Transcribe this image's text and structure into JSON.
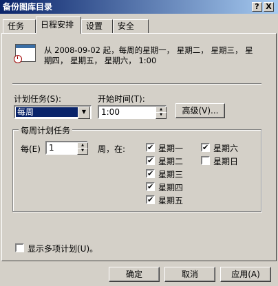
{
  "window": {
    "title": "备份图库目录",
    "help_label": "?",
    "close_label": "X"
  },
  "tabs": [
    {
      "label": "任务"
    },
    {
      "label": "日程安排"
    },
    {
      "label": "设置"
    },
    {
      "label": "安全"
    }
  ],
  "schedule": {
    "description_line1": "从 2008-09-02 起，每周的星期一， 星期二， 星期三， 星",
    "description_line2": "期四， 星期五， 星期六， 1:00",
    "task_label": "计划任务(S):",
    "task_value": "每周",
    "start_time_label": "开始时间(T):",
    "start_time_value": "1:00",
    "advanced_button": "高级(V)..."
  },
  "weekly": {
    "group_title": "每周计划任务",
    "every_label": "每(E)",
    "every_value": "1",
    "weeks_on_label": "周，在:",
    "days": [
      {
        "label": "星期一",
        "checked": true
      },
      {
        "label": "星期二",
        "checked": true
      },
      {
        "label": "星期三",
        "checked": true
      },
      {
        "label": "星期四",
        "checked": true
      },
      {
        "label": "星期五",
        "checked": true
      },
      {
        "label": "星期六",
        "checked": true
      },
      {
        "label": "星期日",
        "checked": false
      }
    ]
  },
  "footer": {
    "multiple_schedules_label": "显示多项计划(U)。",
    "multiple_schedules_checked": false,
    "ok_label": "确定",
    "cancel_label": "取消",
    "apply_label": "应用(A)"
  },
  "icons": {
    "checkmark": "✔",
    "dropdown": "▼",
    "spin_up": "▲",
    "spin_down": "▼"
  },
  "colors": {
    "titlebar_start": "#0a246a",
    "titlebar_end": "#a6caf0",
    "dialog_bg": "#d4d0c8",
    "selection_bg": "#0a246a"
  }
}
